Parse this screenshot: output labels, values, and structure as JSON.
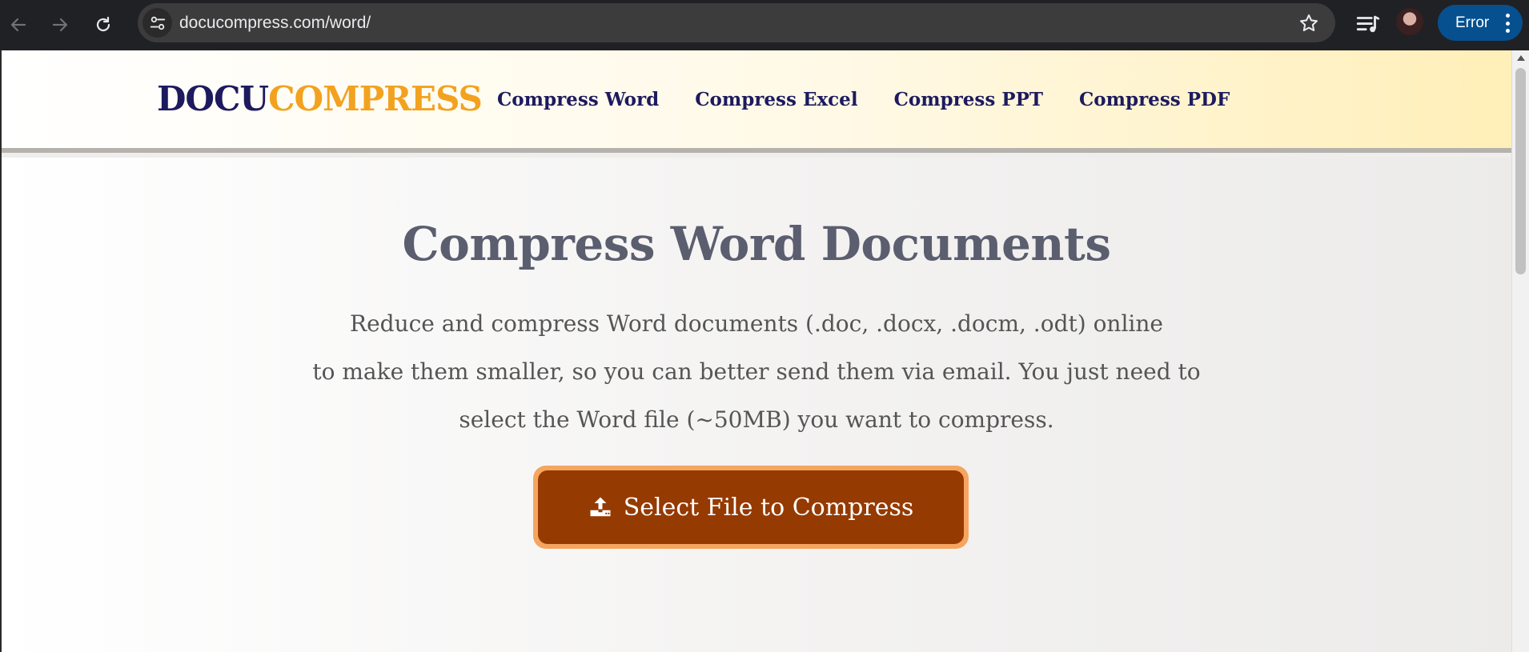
{
  "browser": {
    "url": "docucompress.com/word/",
    "profile_status": "Error",
    "icons": [
      "back-arrow-icon",
      "forward-arrow-icon",
      "reload-icon",
      "site-settings-icon",
      "bookmark-star-icon",
      "media-control-icon",
      "profile-avatar",
      "kebab-menu-icon"
    ]
  },
  "header": {
    "logo_part1": "DOCU",
    "logo_part2": "COMPRESS",
    "nav": [
      {
        "label": "Compress Word"
      },
      {
        "label": "Compress Excel"
      },
      {
        "label": "Compress PPT"
      },
      {
        "label": "Compress PDF"
      }
    ]
  },
  "hero": {
    "title": "Compress Word Documents",
    "description_lines": [
      "Reduce and compress Word documents (.doc, .docx, .docm, .odt) online",
      "to make them smaller, so you can better send them via email. You just need to",
      "select the Word file (~50MB) you want to compress."
    ],
    "cta_label": "Select File to Compress",
    "cta_icon": "upload-icon"
  },
  "colors": {
    "logo_primary": "#1e1a5e",
    "logo_accent": "#f2a21f",
    "cta_bg": "#953a00",
    "cta_border": "#f5a55f",
    "title": "#5b5e6f"
  }
}
